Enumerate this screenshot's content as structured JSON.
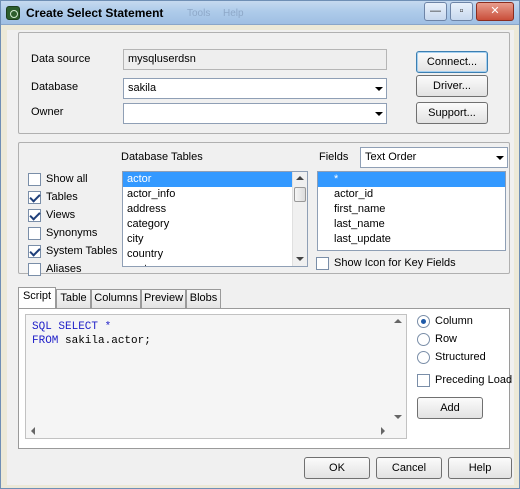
{
  "window": {
    "title": "Create Select Statement",
    "ghost_menu": [
      "Tools",
      "Help"
    ],
    "controls": {
      "minimize": "—",
      "maximize": "▫",
      "close": "✕"
    }
  },
  "connection": {
    "data_source_label": "Data source",
    "data_source_value": "mysqluserdsn",
    "database_label": "Database",
    "database_value": "sakila",
    "owner_label": "Owner",
    "owner_value": "",
    "connect_button": "Connect...",
    "driver_button": "Driver...",
    "support_button": "Support..."
  },
  "object_types": {
    "items": [
      {
        "label": "Show all",
        "checked": false
      },
      {
        "label": "Tables",
        "checked": true
      },
      {
        "label": "Views",
        "checked": true
      },
      {
        "label": "Synonyms",
        "checked": false
      },
      {
        "label": "System Tables",
        "checked": true
      },
      {
        "label": "Aliases",
        "checked": false
      }
    ]
  },
  "tables": {
    "heading": "Database Tables",
    "items": [
      "actor",
      "actor_info",
      "address",
      "category",
      "city",
      "country",
      "customer"
    ],
    "selected": "actor"
  },
  "fields": {
    "label": "Fields",
    "order_value": "Text Order",
    "items": [
      "*",
      "actor_id",
      "first_name",
      "last_name",
      "last_update"
    ],
    "selected": "*",
    "show_icon_label": "Show Icon for Key Fields",
    "show_icon_checked": false
  },
  "tabs": [
    "Script",
    "Table",
    "Columns",
    "Preview",
    "Blobs"
  ],
  "active_tab": "Script",
  "script": {
    "line1_kw": "SQL SELECT *",
    "line2_kw": "FROM",
    "line2_rest": " sakila.actor;"
  },
  "options": {
    "column_label": "Column",
    "row_label": "Row",
    "structured_label": "Structured",
    "selected": "Column",
    "preceding_load_label": "Preceding Load",
    "preceding_load_checked": false,
    "add_button": "Add"
  },
  "footer": {
    "ok_button": "OK",
    "cancel_button": "Cancel",
    "help_button": "Help"
  },
  "colors": {
    "selection": "#3399ff",
    "keyword": "#1e1ec8",
    "dialog_bg": "#f0f0f0"
  }
}
